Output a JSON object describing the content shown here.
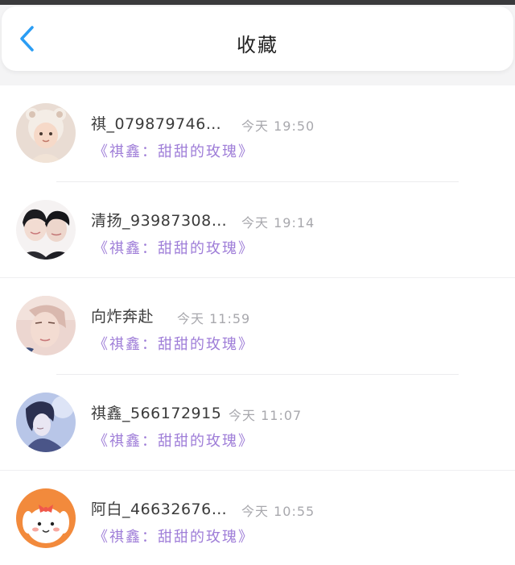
{
  "header": {
    "title": "收藏"
  },
  "items": [
    {
      "name": "祺_079879746…",
      "time": "今天 19:50",
      "song": "《祺鑫：甜甜的玫瑰》"
    },
    {
      "name": "清扬_93987308…",
      "time": "今天 19:14",
      "song": "《祺鑫：甜甜的玫瑰》"
    },
    {
      "name": "向炸奔赴",
      "time": "今天 11:59",
      "song": "《祺鑫：甜甜的玫瑰》"
    },
    {
      "name": "祺鑫_566172915",
      "time": "今天 11:07",
      "song": "《祺鑫：甜甜的玫瑰》"
    },
    {
      "name": "阿白_46632676…",
      "time": "今天 10:55",
      "song": "《祺鑫：甜甜的玫瑰》"
    }
  ],
  "colors": {
    "accent": "#2a9df4",
    "song_text": "#9f7ed8"
  },
  "icons": {
    "back": "chevron-left-icon"
  }
}
